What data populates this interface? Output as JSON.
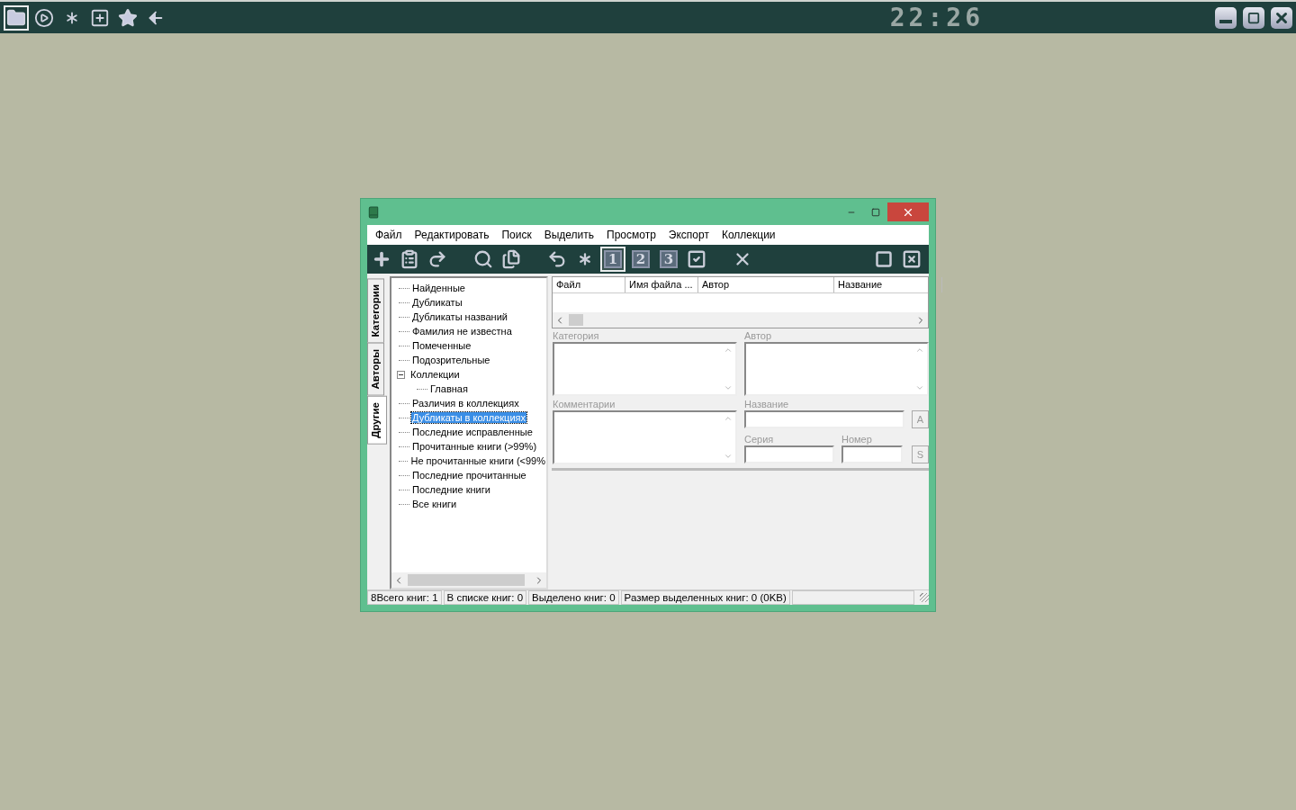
{
  "launcher": [
    {
      "kind": "folder",
      "selected": true
    },
    {
      "kind": "play",
      "selected": false
    },
    {
      "kind": "asterisk",
      "selected": false
    },
    {
      "kind": "add",
      "selected": false
    },
    {
      "kind": "star",
      "selected": false
    },
    {
      "kind": "back",
      "selected": false
    }
  ],
  "clock": "22:26",
  "menu": [
    "Файл",
    "Редактировать",
    "Поиск",
    "Выделить",
    "Просмотр",
    "Экспорт",
    "Коллекции"
  ],
  "toolbar": [
    {
      "kind": "add",
      "selected": false
    },
    {
      "kind": "paste",
      "selected": false
    },
    {
      "kind": "redo",
      "selected": false
    },
    {
      "kind": "gap"
    },
    {
      "kind": "search",
      "selected": false
    },
    {
      "kind": "copy",
      "selected": false
    },
    {
      "kind": "gap"
    },
    {
      "kind": "undo",
      "selected": false
    },
    {
      "kind": "asterisk",
      "selected": false
    },
    {
      "kind": "number",
      "label": "1",
      "selected": true
    },
    {
      "kind": "number",
      "label": "2",
      "selected": false
    },
    {
      "kind": "number",
      "label": "3",
      "selected": false
    },
    {
      "kind": "check",
      "selected": false
    },
    {
      "kind": "gap"
    },
    {
      "kind": "delete",
      "selected": false
    }
  ],
  "side_tabs": [
    {
      "label": "Категории",
      "selected": false
    },
    {
      "label": "Авторы",
      "selected": false
    },
    {
      "label": "Другие",
      "selected": true
    }
  ],
  "tree": [
    {
      "label": "Найденные",
      "selected": false
    },
    {
      "label": "Дубликаты",
      "selected": false
    },
    {
      "label": "Дубликаты названий",
      "selected": false
    },
    {
      "label": "Фамилия не известна",
      "selected": false
    },
    {
      "label": "Помеченные",
      "selected": false
    },
    {
      "label": "Подозрительные",
      "selected": false
    },
    {
      "label": "Коллекции",
      "selected": false,
      "expanded": true,
      "children": [
        {
          "label": "Главная",
          "selected": false
        }
      ]
    },
    {
      "label": "Различия в коллекциях",
      "selected": false
    },
    {
      "label": "Дубликаты в коллекциях",
      "selected": true
    },
    {
      "label": "Последние исправленные",
      "selected": false
    },
    {
      "label": "Прочитанные книги (>99%)",
      "selected": false
    },
    {
      "label": "Не прочитанные книги (<99%",
      "selected": false
    },
    {
      "label": "Последние прочитанные",
      "selected": false
    },
    {
      "label": "Последние книги",
      "selected": false
    },
    {
      "label": "Все книги",
      "selected": false
    }
  ],
  "table": {
    "columns": [
      "Файл",
      "Имя файла ...",
      "Автор",
      "Название"
    ]
  },
  "details": {
    "category": "Категория",
    "author": "Автор",
    "comments": "Комментарии",
    "title": "Название",
    "title_button": "A",
    "series": "Серия",
    "number": "Номер",
    "series_button": "S"
  },
  "status_bar": [
    "8Всего книг: 1",
    "В списке книг: 0",
    "Выделено книг: 0",
    "Размер выделенных книг: 0  (0KB)"
  ]
}
